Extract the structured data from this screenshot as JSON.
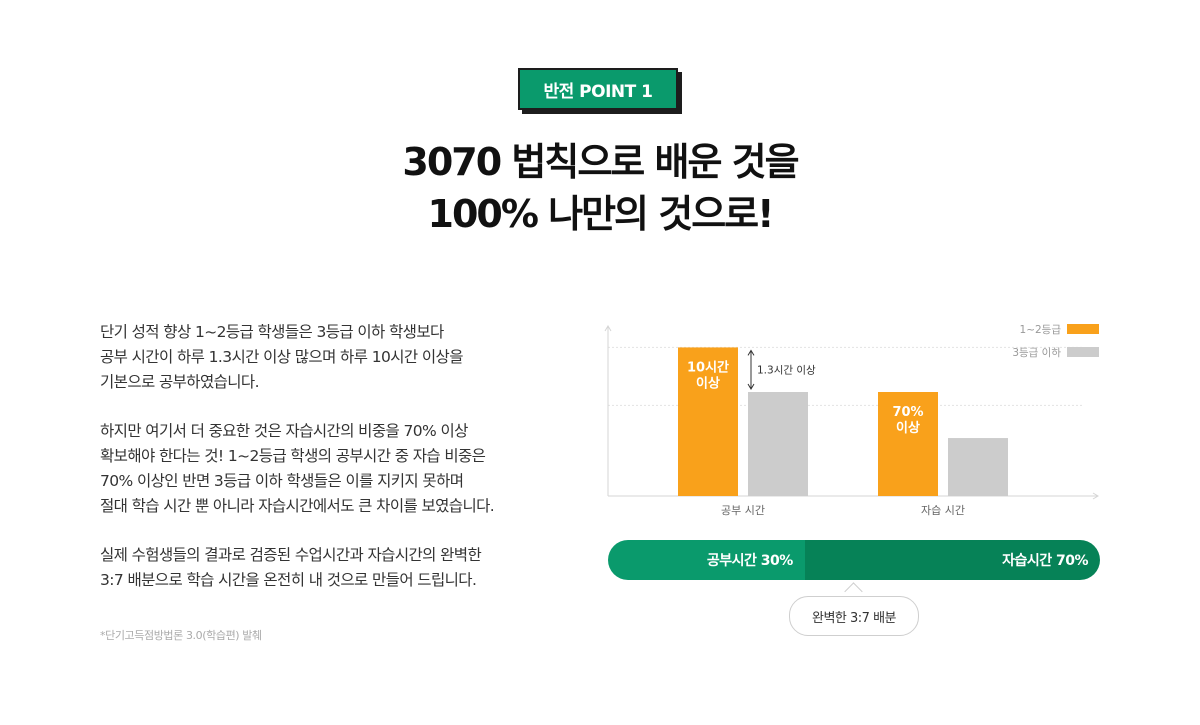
{
  "badge": {
    "label": "반전 POINT 1"
  },
  "headline": {
    "line1": "3070 법칙으로 배운 것을",
    "line2": "100% 나만의 것으로!"
  },
  "body": {
    "p1": [
      "단기 성적 향상 1~2등급 학생들은 3등급 이하 학생보다",
      "공부 시간이 하루 1.3시간 이상 많으며 하루 10시간 이상을",
      "기본으로 공부하였습니다."
    ],
    "p2": [
      "하지만 여기서 더 중요한 것은 자습시간의 비중을 70% 이상",
      "확보해야 한다는 것! 1~2등급 학생의 공부시간 중 자습 비중은",
      "70% 이상인 반면 3등급 이하 학생들은 이를 지키지 못하며",
      "절대 학습 시간 뿐 아니라 자습시간에서도 큰 차이를 보였습니다."
    ],
    "p3": [
      "실제 수험생들의 결과로 검증된 수업시간과 자습시간의 완벽한",
      "3:7 배분으로 학습 시간을 온전히 내 것으로 만들어 드립니다."
    ]
  },
  "footnote": "*단기고득점방법론 3.0(학습편) 발췌",
  "chart_data": {
    "type": "bar",
    "categories": [
      "공부 시간",
      "자습 시간"
    ],
    "series": [
      {
        "name": "1~2등급",
        "values": [
          10,
          7.0
        ],
        "labels": [
          "10시간\n이상",
          "70%\n이상"
        ],
        "color": "#f9a11b"
      },
      {
        "name": "3등급 이하",
        "values": [
          7.0,
          3.9
        ],
        "color": "#cccccc"
      }
    ],
    "annotation": "1.3시간 이상",
    "ylim": [
      0,
      10.5
    ],
    "grid": true,
    "legend": "top-right"
  },
  "ratio": {
    "study_label": "공부시간 30%",
    "self_label": "자습시간 70%",
    "study_fraction": 0.4
  },
  "callout": "완벽한 3:7 배분"
}
